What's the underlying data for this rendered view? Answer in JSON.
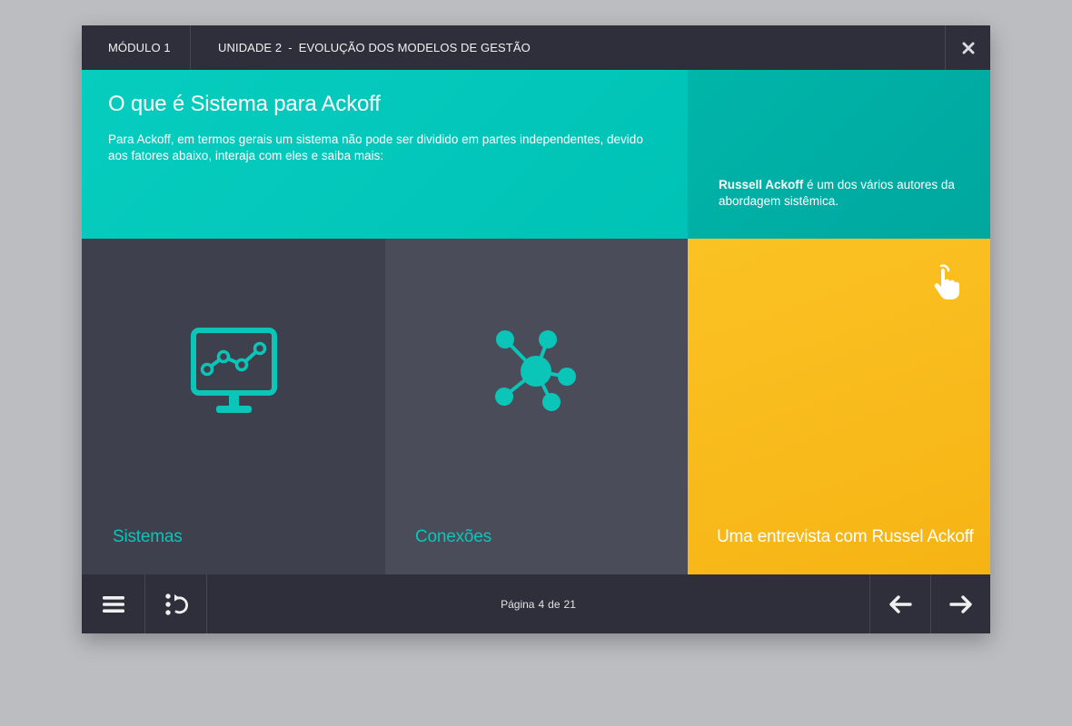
{
  "header": {
    "module_label": "MÓDULO 1",
    "unit_label": "UNIDADE 2",
    "unit_separator": "-",
    "unit_title": "EVOLUÇÃO DOS MODELOS DE GESTÃO",
    "close_icon": "close-icon"
  },
  "intro": {
    "title": "O que é Sistema para Ackoff",
    "text": "Para Ackoff, em termos gerais um sistema não pode ser dividido em partes independentes, devido aos fatores abaixo, interaja com eles e saiba mais:"
  },
  "author": {
    "name": "Russell Ackoff",
    "description": " é um dos vários autores da abordagem sistêmica."
  },
  "tiles": [
    {
      "label": "Sistemas",
      "icon": "monitor-chart-icon"
    },
    {
      "label": "Conexões",
      "icon": "network-icon"
    },
    {
      "label": "Uma entrevista com Russel Ackoff",
      "icon": "hand-pointer-icon"
    }
  ],
  "footer": {
    "page_prefix": "Página",
    "current_page": "4",
    "page_separator": "de",
    "total_pages": "21",
    "menu_icon": "hamburger-menu-icon",
    "index_icon": "index-back-icon",
    "prev_icon": "arrow-left-icon",
    "next_icon": "arrow-right-icon"
  },
  "colors": {
    "background": "#bcbdc1",
    "bar": "#2e2f3b",
    "teal": "#06cdbf",
    "teal_dark": "#00ada3",
    "tile_dark": "#3e404d",
    "tile_mid": "#4a4c5a",
    "yellow": "#f8b91b"
  }
}
